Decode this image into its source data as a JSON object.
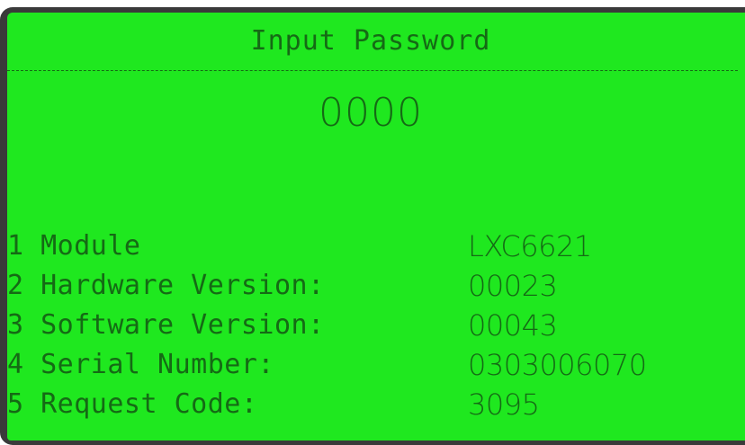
{
  "screen": {
    "title": "Input Password",
    "password_value": "0000"
  },
  "info_rows": [
    {
      "label": "1 Module",
      "value": "LXC6621"
    },
    {
      "label": "2 Hardware Version:",
      "value": "00023"
    },
    {
      "label": "3 Software Version:",
      "value": "00043"
    },
    {
      "label": "4 Serial Number:",
      "value": "0303006070"
    },
    {
      "label": "5 Request Code:",
      "value": "3095"
    }
  ],
  "colors": {
    "lcd_background": "#1fe81f",
    "lcd_text": "#156a15",
    "bezel": "#3a3a3a"
  }
}
